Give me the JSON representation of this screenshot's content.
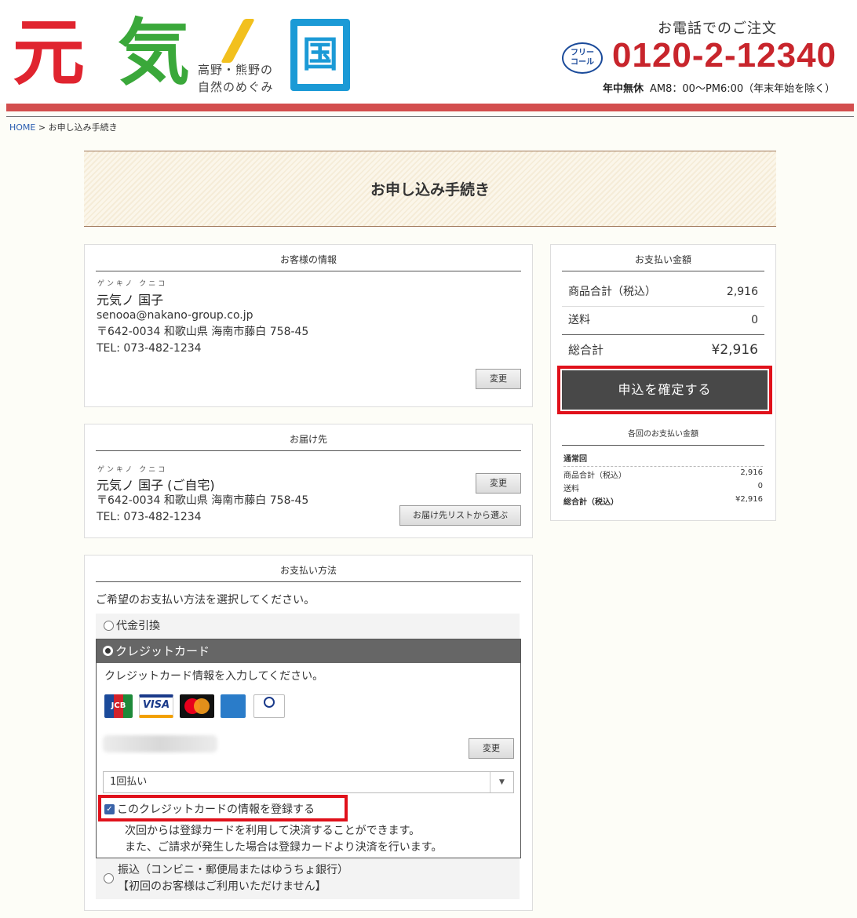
{
  "header": {
    "logo": {
      "char1": "元",
      "char2": "気",
      "subtitle_line1": "高野・熊野の",
      "subtitle_line2": "自然のめぐみ",
      "char3": "国"
    },
    "phone": {
      "caption": "お電話でのご注文",
      "icon_label_line1": "フリー",
      "icon_label_line2": "コール",
      "number": "0120-2-12340",
      "days": "年中無休",
      "hours": "AM8：00〜PM6:00（年末年始を除く）"
    }
  },
  "breadcrumb": {
    "home": "HOME",
    "separator": " > ",
    "current": "お申し込み手続き"
  },
  "page_title": "お申し込み手続き",
  "customer": {
    "heading": "お客様の情報",
    "kana": "ゲンキノ クニコ",
    "name": "元気ノ 国子",
    "email": "senooa@nakano-group.co.jp",
    "address": "〒642-0034 和歌山県 海南市藤白 758-45",
    "tel": "TEL: 073-482-1234",
    "change_button": "変更"
  },
  "delivery": {
    "heading": "お届け先",
    "kana": "ゲンキノ クニコ",
    "name": "元気ノ 国子 (ご自宅)",
    "address": "〒642-0034 和歌山県 海南市藤白 758-45",
    "tel": "TEL: 073-482-1234",
    "change_button": "変更",
    "choose_list_button": "お届け先リストから選ぶ"
  },
  "summary": {
    "heading": "お支払い金額",
    "subtotal_label": "商品合計（税込）",
    "subtotal_value": "2,916",
    "shipping_label": "送料",
    "shipping_value": "0",
    "total_label": "総合計",
    "total_value": "¥2,916",
    "confirm_button": "申込を確定する",
    "per_time_heading": "各回のお支払い金額",
    "regular_label": "通常回",
    "regular_subtotal_label": "商品合計（税込）",
    "regular_subtotal_value": "2,916",
    "regular_shipping_label": "送料",
    "regular_shipping_value": "0",
    "regular_total_label": "総合計（税込）",
    "regular_total_value": "¥2,916"
  },
  "payment": {
    "heading": "お支払い方法",
    "intro": "ご希望のお支払い方法を選択してください。",
    "option_cod": "代金引換",
    "option_credit": "クレジットカード",
    "credit_prompt": "クレジットカード情報を入力してください。",
    "card_brands": [
      "JCB",
      "VISA",
      "mastercard",
      "AMERICAN EXPRESS",
      "Diners Club INTERNATIONAL"
    ],
    "card_change_button": "変更",
    "installment_selected": "1回払い",
    "save_card_label": "このクレジットカードの情報を登録する",
    "save_card_checked": true,
    "save_note_line1": "次回からは登録カードを利用して決済することができます。",
    "save_note_line2": "また、ご請求が発生した場合は登録カードより決済を行います。",
    "option_transfer_line1": "振込（コンビニ・郵便局またはゆうちょ銀行）",
    "option_transfer_line2": "【初回のお客様はご利用いただけません】"
  }
}
